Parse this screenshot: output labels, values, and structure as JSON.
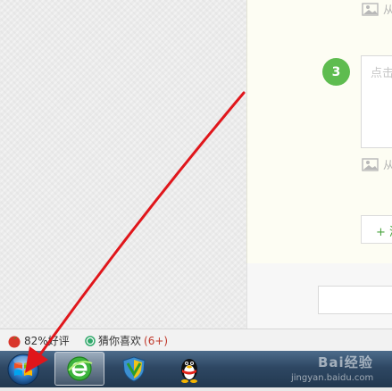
{
  "content": {
    "upload_label": "从",
    "step_number": "3",
    "step_placeholder": "点击",
    "add_step_label": "+ 添加"
  },
  "status_bar": {
    "rating_text": "82%好评",
    "guess_label": "猜你喜欢",
    "guess_count": "(6+)"
  },
  "watermark": {
    "brand": "Bai经验",
    "url": "jingyan.baidu.com"
  },
  "icons": [
    "image-icon",
    "tomato-icon",
    "green-dot-icon",
    "windows-start-icon",
    "browser-e-icon",
    "shield-icon",
    "qq-penguin-icon",
    "red-arrow"
  ],
  "colors": {
    "step_green": "#5ebc4f",
    "arrow_red": "#e0161b",
    "count_red": "#c0392b",
    "taskbar_blue": "#2e4763"
  }
}
